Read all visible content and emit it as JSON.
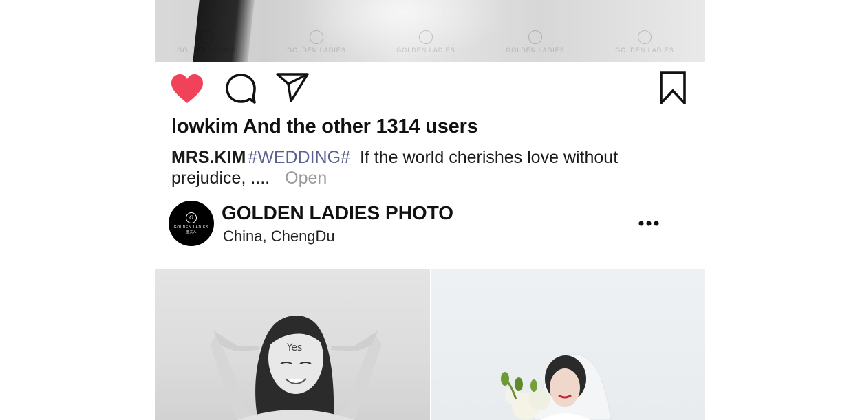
{
  "post_top": {
    "watermarks": [
      "GOLDEN LADIES",
      "GOLDEN LADIES",
      "GOLDEN LADIES",
      "GOLDEN LADIES",
      "GOLDEN LADIES"
    ]
  },
  "actions": {
    "like_icon": "heart-icon",
    "comment_icon": "comment-icon",
    "share_icon": "send-icon",
    "save_icon": "bookmark-icon",
    "like_color": "#f0435a"
  },
  "likes_text": "lowkim And the other 1314 users",
  "caption": {
    "author": "MRS.KIM",
    "hashtag": "#WEDDING#",
    "text": "If the world cherishes love without prejudice, ....",
    "more": "Open"
  },
  "account": {
    "avatar_monogram": "G",
    "avatar_brand": "GOLDEN LADIES",
    "avatar_brand_cn": "金夫人",
    "name": "GOLDEN LADIES PHOTO",
    "location": "China,  ChengDu",
    "menu_icon": "more-dots-icon"
  },
  "photos": {
    "left_text": "Yes"
  },
  "colors": {
    "hashtag": "#5b5f92",
    "muted": "#9a9a9a",
    "heart": "#f0435a"
  }
}
